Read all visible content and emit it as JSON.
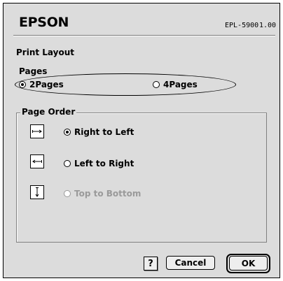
{
  "header": {
    "brand": "EPSON",
    "model": "EPL-5900",
    "version": "1.00"
  },
  "title": "Print Layout",
  "pages": {
    "label": "Pages",
    "options": [
      {
        "label": "2Pages",
        "selected": true
      },
      {
        "label": "4Pages",
        "selected": false
      }
    ]
  },
  "page_order": {
    "label": "Page Order",
    "options": [
      {
        "label": "Right to Left",
        "selected": true,
        "enabled": true
      },
      {
        "label": "Left to Right",
        "selected": false,
        "enabled": true
      },
      {
        "label": "Top to Bottom",
        "selected": false,
        "enabled": false
      }
    ]
  },
  "buttons": {
    "help": "?",
    "cancel": "Cancel",
    "ok": "OK"
  }
}
